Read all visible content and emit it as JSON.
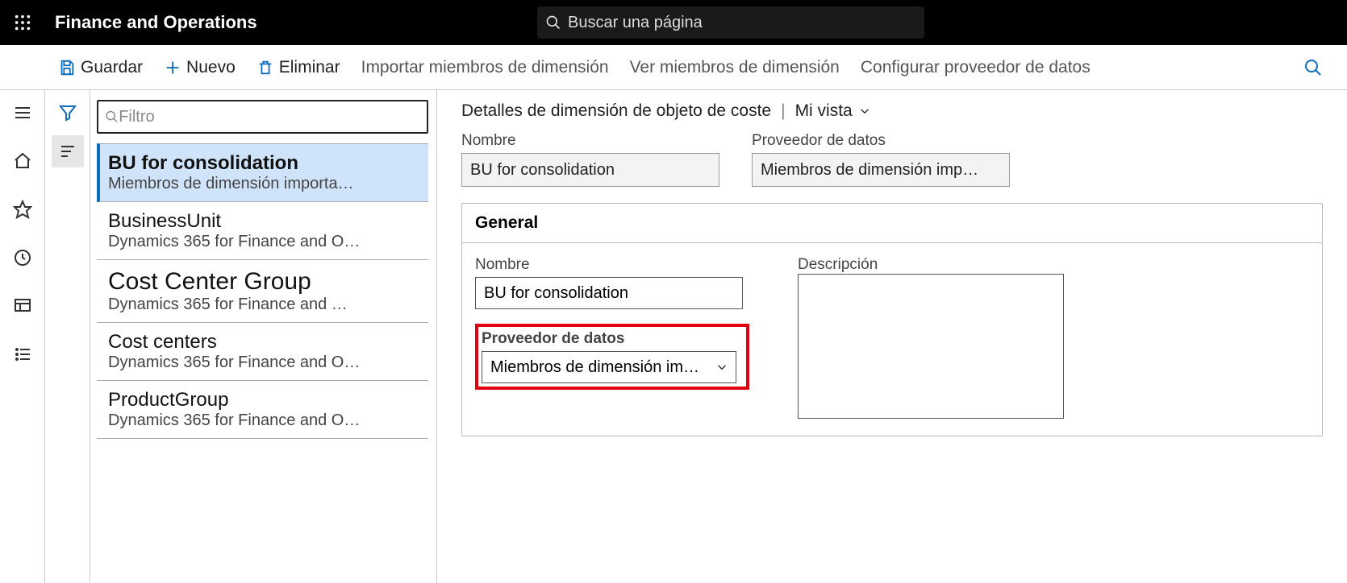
{
  "appbar": {
    "title": "Finance and Operations",
    "search_placeholder": "Buscar una página"
  },
  "actionbar": {
    "save": "Guardar",
    "new": "Nuevo",
    "delete": "Eliminar",
    "import": "Importar miembros de dimensión",
    "view": "Ver miembros de dimensión",
    "configure": "Configurar proveedor de datos"
  },
  "listpanel": {
    "filter_placeholder": "Filtro",
    "items": [
      {
        "title": "BU for consolidation",
        "sub": "Miembros de dimensión importa…",
        "selected": true
      },
      {
        "title": "BusinessUnit",
        "sub": "Dynamics 365 for Finance and O…"
      },
      {
        "title": "Cost Center Group",
        "sub": "Dynamics 365 for Finance and …",
        "big": true
      },
      {
        "title": "Cost centers",
        "sub": "Dynamics 365 for Finance and O…"
      },
      {
        "title": "ProductGroup",
        "sub": "Dynamics 365 for Finance and O…"
      }
    ]
  },
  "detail": {
    "crumb_title": "Detalles de dimensión de objeto de coste",
    "view_label": "Mi vista",
    "header_name_label": "Nombre",
    "header_name_value": "BU for consolidation",
    "header_prov_label": "Proveedor de datos",
    "header_prov_value": "Miembros de dimensión imp…",
    "section_title": "General",
    "name_label": "Nombre",
    "name_value": "BU for consolidation",
    "prov_label": "Proveedor de datos",
    "prov_value": "Miembros de dimensión im…",
    "desc_label": "Descripción",
    "desc_value": ""
  }
}
